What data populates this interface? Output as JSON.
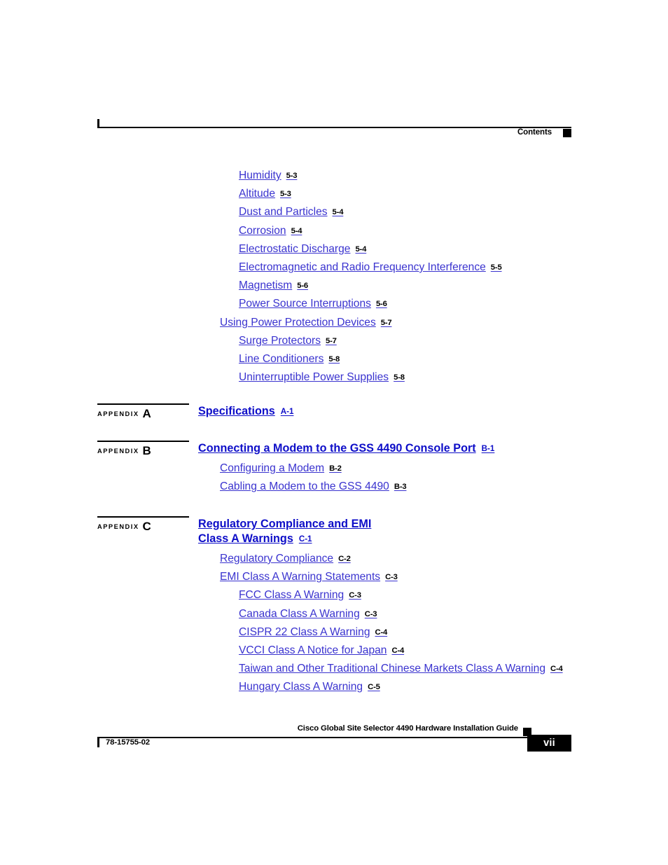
{
  "header": {
    "label": "Contents",
    "marker": "black-square"
  },
  "toc": {
    "chapter5_entries": [
      {
        "label": "Humidity",
        "page": "5-3",
        "level": 2
      },
      {
        "label": "Altitude",
        "page": "5-3",
        "level": 2
      },
      {
        "label": "Dust and Particles",
        "page": "5-4",
        "level": 2
      },
      {
        "label": "Corrosion",
        "page": "5-4",
        "level": 2
      },
      {
        "label": "Electrostatic Discharge",
        "page": "5-4",
        "level": 2
      },
      {
        "label": "Electromagnetic and Radio Frequency Interference",
        "page": "5-5",
        "level": 2
      },
      {
        "label": "Magnetism",
        "page": "5-6",
        "level": 2
      },
      {
        "label": "Power Source Interruptions",
        "page": "5-6",
        "level": 2
      },
      {
        "label": "Using Power Protection Devices",
        "page": "5-7",
        "level": 1
      },
      {
        "label": "Surge Protectors",
        "page": "5-7",
        "level": 2
      },
      {
        "label": "Line Conditioners",
        "page": "5-8",
        "level": 2
      },
      {
        "label": "Uninterruptible Power Supplies",
        "page": "5-8",
        "level": 2
      }
    ],
    "appendices": [
      {
        "tag_word": "APPENDIX",
        "tag_letter": "A",
        "title_line1": "Specifications",
        "title_line2": "",
        "page": "A-1",
        "entries": []
      },
      {
        "tag_word": "APPENDIX",
        "tag_letter": "B",
        "title_line1": "Connecting a Modem to the GSS 4490 Console Port",
        "title_line2": "",
        "page": "B-1",
        "entries": [
          {
            "label": "Configuring a Modem",
            "page": "B-2",
            "level": 1
          },
          {
            "label": "Cabling a Modem to the GSS 4490",
            "page": "B-3",
            "level": 1
          }
        ]
      },
      {
        "tag_word": "APPENDIX",
        "tag_letter": "C",
        "title_line1": "Regulatory Compliance and EMI",
        "title_line2": "Class A Warnings",
        "page": "C-1",
        "entries": [
          {
            "label": "Regulatory Compliance",
            "page": "C-2",
            "level": 1
          },
          {
            "label": "EMI Class A Warning Statements",
            "page": "C-3",
            "level": 1
          },
          {
            "label": "FCC Class A Warning",
            "page": "C-3",
            "level": 2
          },
          {
            "label": "Canada Class A Warning",
            "page": "C-3",
            "level": 2
          },
          {
            "label": "CISPR 22 Class A Warning",
            "page": "C-4",
            "level": 2
          },
          {
            "label": "VCCI Class A Notice for Japan",
            "page": "C-4",
            "level": 2
          },
          {
            "label": "Taiwan and Other Traditional Chinese Markets Class A Warning",
            "page": "C-4",
            "level": 2
          },
          {
            "label": "Hungary Class A Warning",
            "page": "C-5",
            "level": 2
          }
        ]
      }
    ]
  },
  "footer": {
    "guide_title": "Cisco Global Site Selector 4490 Hardware Installation Guide",
    "doc_number": "78-15755-02",
    "page_number": "vii"
  },
  "colors": {
    "link_blue": "#3a33cf",
    "heading_blue": "#0e0ec8",
    "black": "#000000",
    "page_background": "#ffffff"
  }
}
